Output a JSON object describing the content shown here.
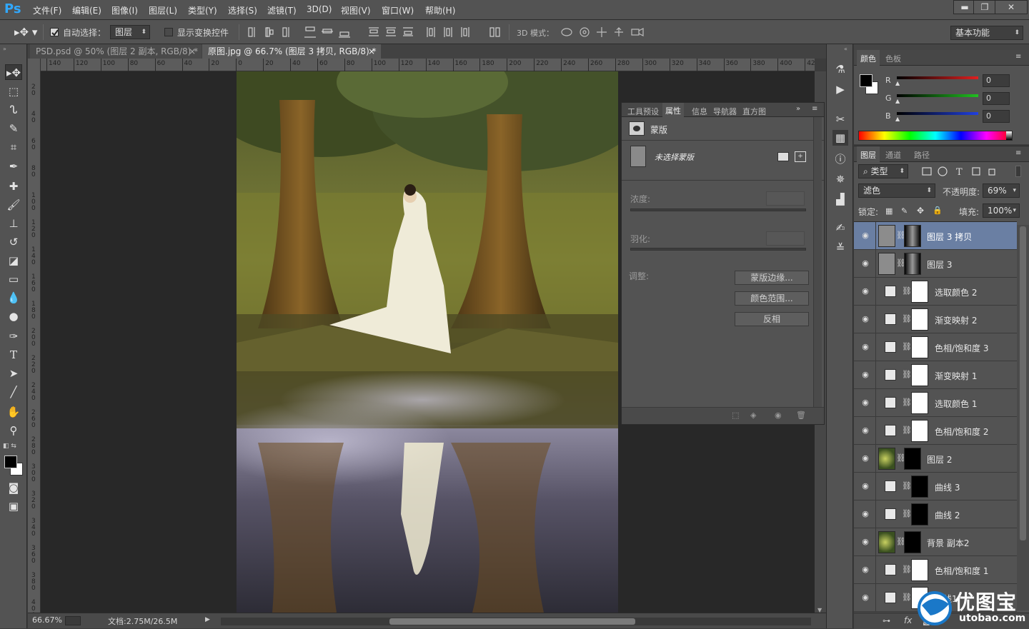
{
  "app": {
    "logo": "Ps"
  },
  "menu": [
    "文件(F)",
    "编辑(E)",
    "图像(I)",
    "图层(L)",
    "类型(Y)",
    "选择(S)",
    "滤镜(T)",
    "3D(D)",
    "视图(V)",
    "窗口(W)",
    "帮助(H)"
  ],
  "window_controls": {
    "minimize": "▬",
    "restore": "❐",
    "close": "✕"
  },
  "options": {
    "auto_select_label": "自动选择：",
    "auto_select_target": "图层",
    "show_transform_label": "显示变换控件",
    "mode3d_label": "3D 模式：",
    "workspace": "基本功能"
  },
  "tabs": [
    {
      "label": "PSD.psd @ 50% (图层 2 副本, RGB/8) *",
      "close": "×",
      "active": false
    },
    {
      "label": "原图.jpg @ 66.7% (图层 3 拷贝, RGB/8) *",
      "close": "×",
      "active": true
    }
  ],
  "ruler_h": [
    "140",
    "120",
    "100",
    "80",
    "60",
    "40",
    "20",
    "0",
    "20",
    "40",
    "60",
    "80",
    "100",
    "120",
    "140",
    "160",
    "180",
    "200",
    "220",
    "240",
    "260",
    "280",
    "300",
    "320",
    "340",
    "360",
    "380",
    "400",
    "42"
  ],
  "ruler_v": [
    "2\n0",
    "4\n0",
    "6\n0",
    "8\n0",
    "1\n0\n0",
    "1\n2\n0",
    "1\n4\n0",
    "1\n6\n0",
    "1\n8\n0",
    "2\n0\n0",
    "2\n2\n0",
    "2\n4\n0",
    "2\n6\n0",
    "2\n8\n0",
    "3\n0\n0",
    "3\n2\n0",
    "3\n4\n0",
    "3\n6\n0",
    "3\n8\n0",
    "4\n0\n0"
  ],
  "status": {
    "zoom": "66.67%",
    "doc": "文档:2.75M/26.5M"
  },
  "properties": {
    "tabs": [
      "工具预设",
      "属性",
      "信息",
      "导航器",
      "直方图"
    ],
    "active_tab": "属性",
    "section_title": "蒙版",
    "mask_status": "未选择蒙版",
    "density_label": "浓度:",
    "feather_label": "羽化:",
    "adjust_label": "调整:",
    "buttons": [
      "蒙版边缘...",
      "颜色范围...",
      "反相"
    ]
  },
  "color_panel": {
    "tabs": [
      "颜色",
      "色板"
    ],
    "channels": [
      {
        "label": "R",
        "value": "0",
        "color": "#e03030"
      },
      {
        "label": "G",
        "value": "0",
        "color": "#30c030"
      },
      {
        "label": "B",
        "value": "0",
        "color": "#3050e0"
      }
    ]
  },
  "layers_panel": {
    "tabs": [
      "图层",
      "通道",
      "路径"
    ],
    "filter_kind": "类型",
    "blend_mode": "滤色",
    "opacity_label": "不透明度:",
    "opacity": "69%",
    "lock_label": "锁定:",
    "fill_label": "填充:",
    "fill": "100%",
    "layers": [
      {
        "name": "图层 3 拷贝",
        "kind": "pixel",
        "mask": "dark-gradient",
        "selected": true
      },
      {
        "name": "图层 3",
        "kind": "pixel",
        "mask": "dark-gradient",
        "selected": false
      },
      {
        "name": "选取颜色 2",
        "kind": "selective-color",
        "mask": "white",
        "selected": false
      },
      {
        "name": "渐变映射 2",
        "kind": "gradient-map",
        "mask": "white",
        "selected": false
      },
      {
        "name": "色相/饱和度 3",
        "kind": "hue-sat",
        "mask": "white",
        "selected": false
      },
      {
        "name": "渐变映射 1",
        "kind": "gradient-map",
        "mask": "white",
        "selected": false
      },
      {
        "name": "选取颜色 1",
        "kind": "selective-color",
        "mask": "white",
        "selected": false
      },
      {
        "name": "色相/饱和度 2",
        "kind": "hue-sat",
        "mask": "white",
        "selected": false
      },
      {
        "name": "图层 2",
        "kind": "photo",
        "mask": "black-silhouette",
        "selected": false
      },
      {
        "name": "曲线 3",
        "kind": "curves",
        "mask": "black",
        "selected": false
      },
      {
        "name": "曲线 2",
        "kind": "curves",
        "mask": "black-figure",
        "selected": false
      },
      {
        "name": "背景 副本2",
        "kind": "photo",
        "mask": "black-figure",
        "selected": false
      },
      {
        "name": "色相/饱和度 1",
        "kind": "hue-sat",
        "mask": "white",
        "selected": false
      },
      {
        "name": "曲线1",
        "kind": "curves",
        "mask": "white",
        "selected": false
      }
    ]
  },
  "watermark": {
    "text": "优图宝",
    "url": "utobao.com"
  }
}
